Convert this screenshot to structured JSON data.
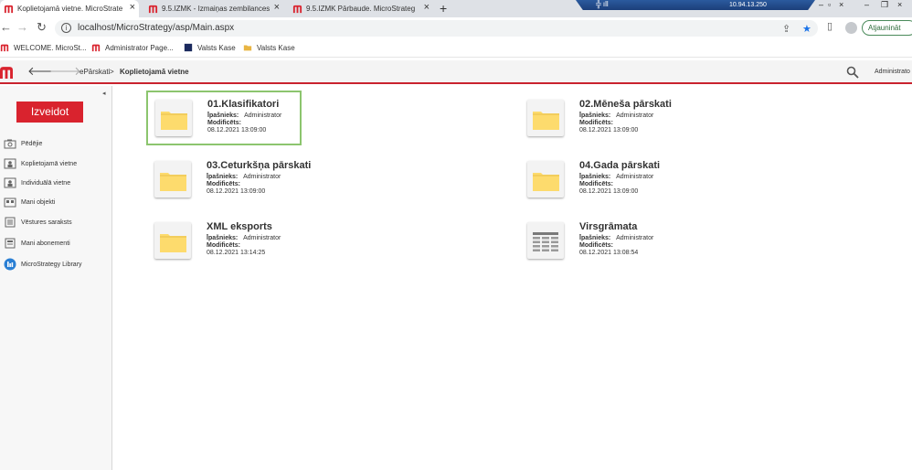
{
  "browser": {
    "tabs": [
      {
        "title": "Koplietojamā vietne. MicroStrate",
        "active": true
      },
      {
        "title": "9.5.IZMK - Izmaiņas zembilances",
        "active": false
      },
      {
        "title": "9.5.IZMK Pārbaude. MicroStrateg",
        "active": false
      }
    ],
    "url": "localhost/MicroStrategy/asp/Main.aspx",
    "update_button": "Atjaunināt",
    "remote_ip": "10.94.13.250"
  },
  "bookmarks": [
    {
      "label": "WELCOME. MicroSt..."
    },
    {
      "label": "Administrator Page..."
    },
    {
      "label": "Valsts Kase"
    },
    {
      "label": "Valsts Kase"
    }
  ],
  "header": {
    "breadcrumb_root": "ePārskati",
    "breadcrumb_sep": ">",
    "breadcrumb_current": "Koplietojamā vietne",
    "user": "Administrato"
  },
  "sidebar": {
    "create_button": "Izveidot",
    "items": [
      {
        "label": "Pēdējie",
        "icon": "camera-icon"
      },
      {
        "label": "Koplietojamā vietne",
        "icon": "shared-folder-icon"
      },
      {
        "label": "Individuālā vietne",
        "icon": "personal-folder-icon"
      },
      {
        "label": "Mani objekti",
        "icon": "objects-icon"
      },
      {
        "label": "Vēstures saraksts",
        "icon": "history-icon"
      },
      {
        "label": "Mani abonementi",
        "icon": "subscriptions-icon"
      },
      {
        "label": "MicroStrategy Library",
        "icon": "library-icon"
      }
    ]
  },
  "content": {
    "owner_label": "Īpašnieks:",
    "modified_label": "Modificēts:",
    "items": [
      {
        "name": "01.Klasifikatori",
        "owner": "Administrator",
        "date": "08.12.2021 13:09:00",
        "type": "folder"
      },
      {
        "name": "02.Mēneša pārskati",
        "owner": "Administrator",
        "date": "08.12.2021 13:09:00",
        "type": "folder"
      },
      {
        "name": "03.Ceturkšņa pārskati",
        "owner": "Administrator",
        "date": "08.12.2021 13:09:00",
        "type": "folder"
      },
      {
        "name": "04.Gada pārskati",
        "owner": "Administrator",
        "date": "08.12.2021 13:09:00",
        "type": "folder"
      },
      {
        "name": "XML eksports",
        "owner": "Administrator",
        "date": "08.12.2021 13:14:25",
        "type": "folder"
      },
      {
        "name": "Virsgrāmata",
        "owner": "Administrator",
        "date": "08.12.2021 13:08:54",
        "type": "report"
      }
    ]
  },
  "colors": {
    "brand_red": "#d9232e",
    "selection_green": "#8cc56e",
    "folder_yellow": "#fddb6d"
  }
}
